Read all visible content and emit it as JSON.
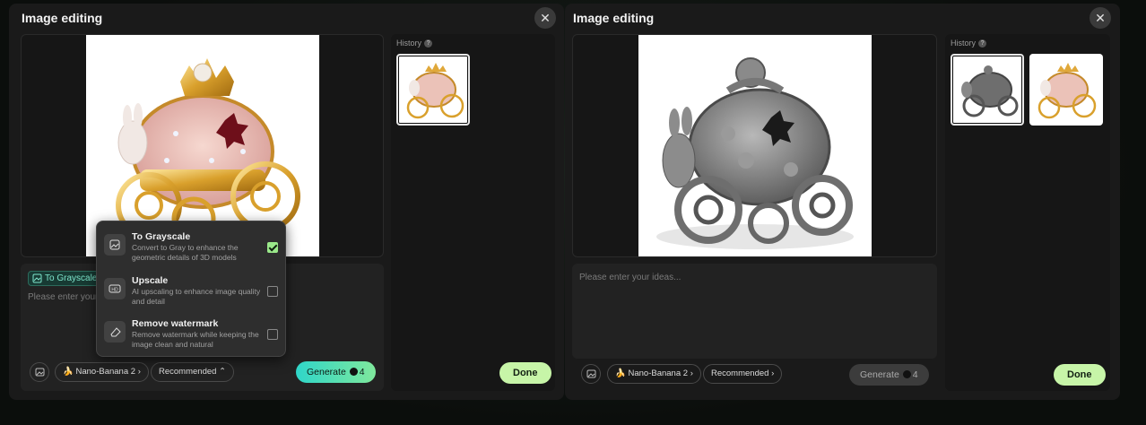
{
  "left_dialog": {
    "title": "Image editing",
    "close_label": "✕",
    "history_label": "History",
    "tag_label": "To Grayscale",
    "prompt_placeholder": "Please enter your ideas...",
    "model_label": "Nano-Banana 2",
    "preset_label": "Recommended",
    "generate_label": "Generate",
    "generate_cost": "4",
    "done_label": "Done",
    "menu": [
      {
        "title": "To Grayscale",
        "desc": "Convert to Gray to enhance the geometric details of 3D models",
        "checked": true
      },
      {
        "title": "Upscale",
        "desc": "AI upscaling to enhance image quality and detail",
        "checked": false
      },
      {
        "title": "Remove watermark",
        "desc": "Remove watermark while keeping the image clean and natural",
        "checked": false
      }
    ]
  },
  "right_dialog": {
    "title": "Image editing",
    "close_label": "✕",
    "history_label": "History",
    "prompt_placeholder": "Please enter your ideas...",
    "model_label": "Nano-Banana 2",
    "preset_label": "Recommended",
    "generate_label": "Generate",
    "generate_cost": "4",
    "done_label": "Done"
  },
  "colors": {
    "panel": "#1a1a1a",
    "accent_gradient_start": "#2fd6c9",
    "accent_gradient_end": "#7fe89c",
    "done_button": "#c7f5a8"
  },
  "icons": [
    "close-icon",
    "help-icon",
    "image-icon",
    "banana-icon",
    "chevron-right-icon",
    "chevron-up-icon",
    "coin-icon",
    "grayscale-icon",
    "upscale-icon",
    "eraser-icon",
    "checkbox-icon"
  ]
}
